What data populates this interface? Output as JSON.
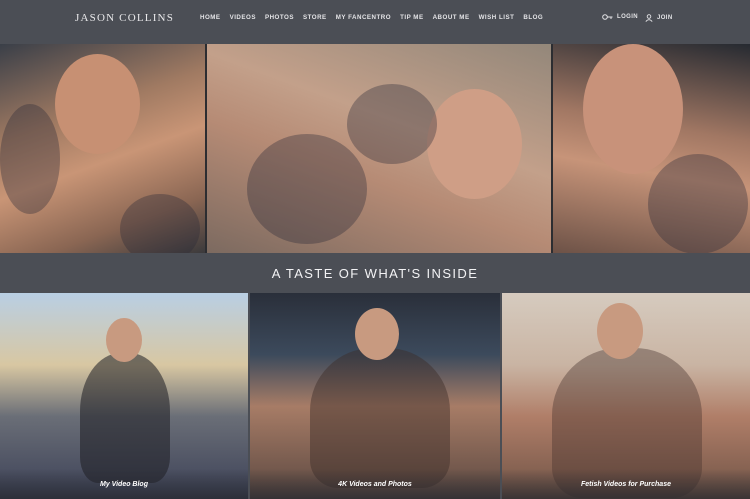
{
  "header": {
    "brand": "JASON COLLINS",
    "nav": [
      "HOME",
      "VIDEOS",
      "PHOTOS",
      "STORE",
      "MY FANCENTRO",
      "TIP ME",
      "ABOUT ME",
      "WISH LIST",
      "BLOG"
    ],
    "login_label": "LOGIN",
    "join_label": "JOIN"
  },
  "section": {
    "title": "A TASTE OF WHAT'S INSIDE"
  },
  "tiles": [
    {
      "caption": "My Video Blog"
    },
    {
      "caption": "4K Videos and Photos"
    },
    {
      "caption": "Fetish Videos for Purchase"
    }
  ],
  "colors": {
    "background": "#4b4e55",
    "text": "#e8e8ea"
  }
}
